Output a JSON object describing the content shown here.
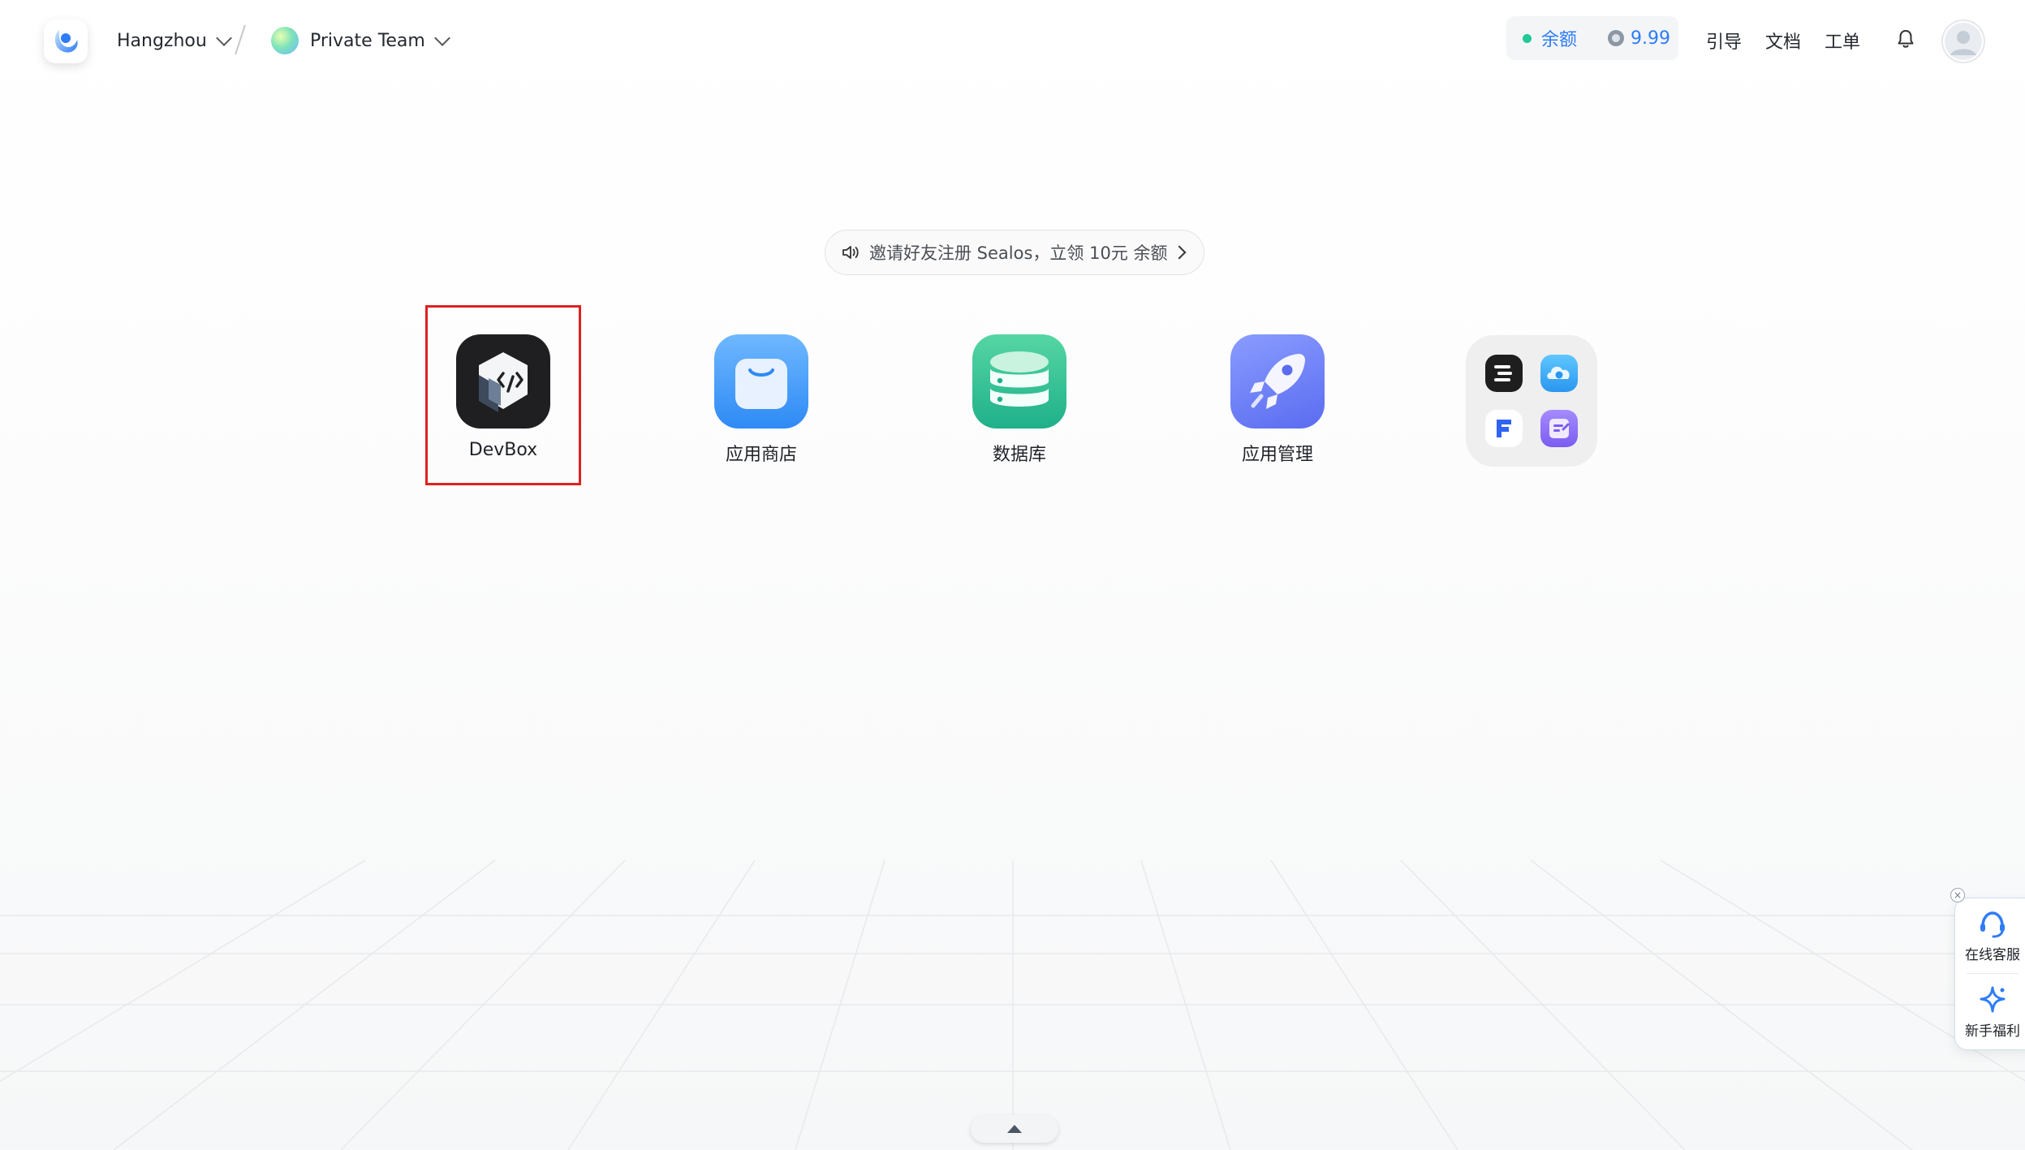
{
  "topbar": {
    "region": "Hangzhou",
    "team": "Private Team",
    "balance": {
      "label": "余额",
      "value": "9.99"
    },
    "links": {
      "guide": "引导",
      "docs": "文档",
      "ticket": "工单"
    }
  },
  "banner": {
    "text": "邀请好友注册 Sealos，立领 10元 余额"
  },
  "apps": [
    {
      "label": "DevBox",
      "icon": "devbox-icon"
    },
    {
      "label": "应用商店",
      "icon": "app-store-bag-icon"
    },
    {
      "label": "数据库",
      "icon": "database-icon"
    },
    {
      "label": "应用管理",
      "icon": "rocket-icon"
    }
  ],
  "widget": {
    "support": "在线客服",
    "welfare": "新手福利"
  },
  "colors": {
    "accent": "#2f7cf6",
    "highlight": "#e02020",
    "status": "#20c997"
  }
}
